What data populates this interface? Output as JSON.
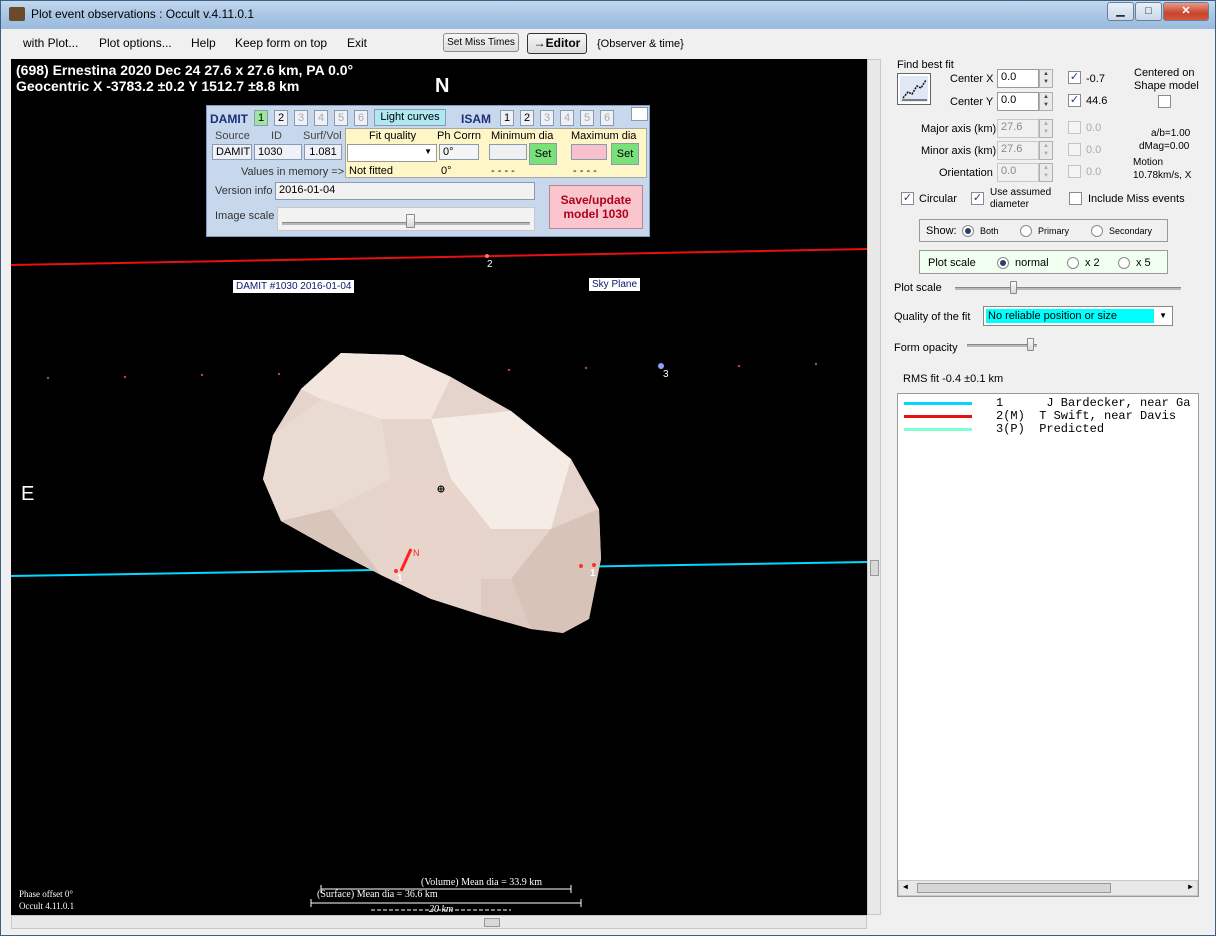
{
  "window": {
    "title": "Plot event observations : Occult v.4.11.0.1",
    "min": "▁",
    "max": "□",
    "close": "✕"
  },
  "menu": {
    "with_plot": "with Plot...",
    "plot_options": "Plot options...",
    "help": "Help",
    "keep_on_top": "Keep form on top",
    "exit": "Exit",
    "set_miss_times": "Set Miss Times",
    "editor": "→Editor",
    "observer_time": "{Observer & time}"
  },
  "plot": {
    "header_line1": "(698) Ernestina  2020 Dec 24  27.6 x 27.6 km, PA 0.0°",
    "header_line2": "Geocentric  X  -3783.2 ±0.2  Y 1512.7 ±8.8 km",
    "north": "N",
    "east": "E",
    "damit_label": "DAMIT #1030 2016-01-04",
    "sky_plane": "Sky Plane",
    "chord_label_1a": "1",
    "chord_label_1b": "1",
    "chord_label_2": "2",
    "chord_label_3": "3",
    "north_arrow": "N",
    "phase_offset": "Phase offset 0°",
    "version": "Occult 4.11.0.1",
    "volume_dia": "(Volume) Mean dia = 33.9 km",
    "surface_dia": "(Surface) Mean dia = 36.6 km",
    "scale_bar": "20 km"
  },
  "damit_panel": {
    "damit": "DAMIT",
    "isam": "ISAM",
    "damit_nums": [
      "1",
      "2",
      "3",
      "4",
      "5",
      "6"
    ],
    "isam_nums": [
      "1",
      "2",
      "3",
      "4",
      "5",
      "6"
    ],
    "light_curves": "Light curves",
    "hdr_source": "Source",
    "hdr_id": "ID",
    "hdr_surf_vol": "Surf/Vol",
    "source": "DAMIT",
    "id": "1030",
    "surf_vol": "1.081",
    "values_in_memory": "Values in memory =>",
    "hdr_fit_quality": "Fit quality",
    "hdr_ph_corrn": "Ph Corrn",
    "hdr_min_dia": "Minimum dia",
    "hdr_max_dia": "Maximum dia",
    "ph_corrn": "0°",
    "not_fitted": "Not fitted",
    "ph_corrn_mem": "0°",
    "min_dash": "- - - -",
    "max_dash": "- - - -",
    "set": "Set",
    "version_info_label": "Version info",
    "version_info": "2016-01-04",
    "image_scale": "Image scale",
    "save_update_1": "Save/update",
    "save_update_2": "model  1030"
  },
  "right": {
    "find_best_fit": "Find best fit",
    "center_x": "Center X",
    "center_x_val": "0.0",
    "center_x_res": "-0.7",
    "center_y": "Center Y",
    "center_y_val": "0.0",
    "center_y_res": "44.6",
    "centered_on": "Centered on",
    "shape_model": "Shape model",
    "major_axis": "Major axis (km)",
    "major_val": "27.6",
    "major_res": "0.0",
    "minor_axis": "Minor axis (km)",
    "minor_val": "27.6",
    "minor_res": "0.0",
    "orientation": "Orientation",
    "orient_val": "0.0",
    "orient_res": "0.0",
    "ab": "a/b=1.00",
    "dmag": "dMag=0.00",
    "motion": "Motion",
    "motion_val": "10.78km/s, X",
    "circular": "Circular",
    "use_assumed_1": "Use assumed",
    "use_assumed_2": "diameter",
    "include_miss": "Include Miss events",
    "show": "Show:",
    "both": "Both",
    "primary": "Primary",
    "secondary": "Secondary",
    "plot_scale_box": "Plot scale",
    "normal": "normal",
    "x2": "x 2",
    "x5": "x 5",
    "plot_scale": "Plot scale",
    "quality_label": "Quality of the fit",
    "quality_val": "No reliable position or size",
    "form_opacity": "Form opacity",
    "rms": "RMS fit -0.4 ±0.1 km",
    "legend": [
      {
        "text": "1      J Bardecker, near Ga",
        "color": "#00d8ff"
      },
      {
        "text": "2(M)  T Swift, near Davis",
        "color": "#e81010"
      },
      {
        "text": "3(P)  Predicted",
        "color": "#7fffd4"
      }
    ]
  }
}
